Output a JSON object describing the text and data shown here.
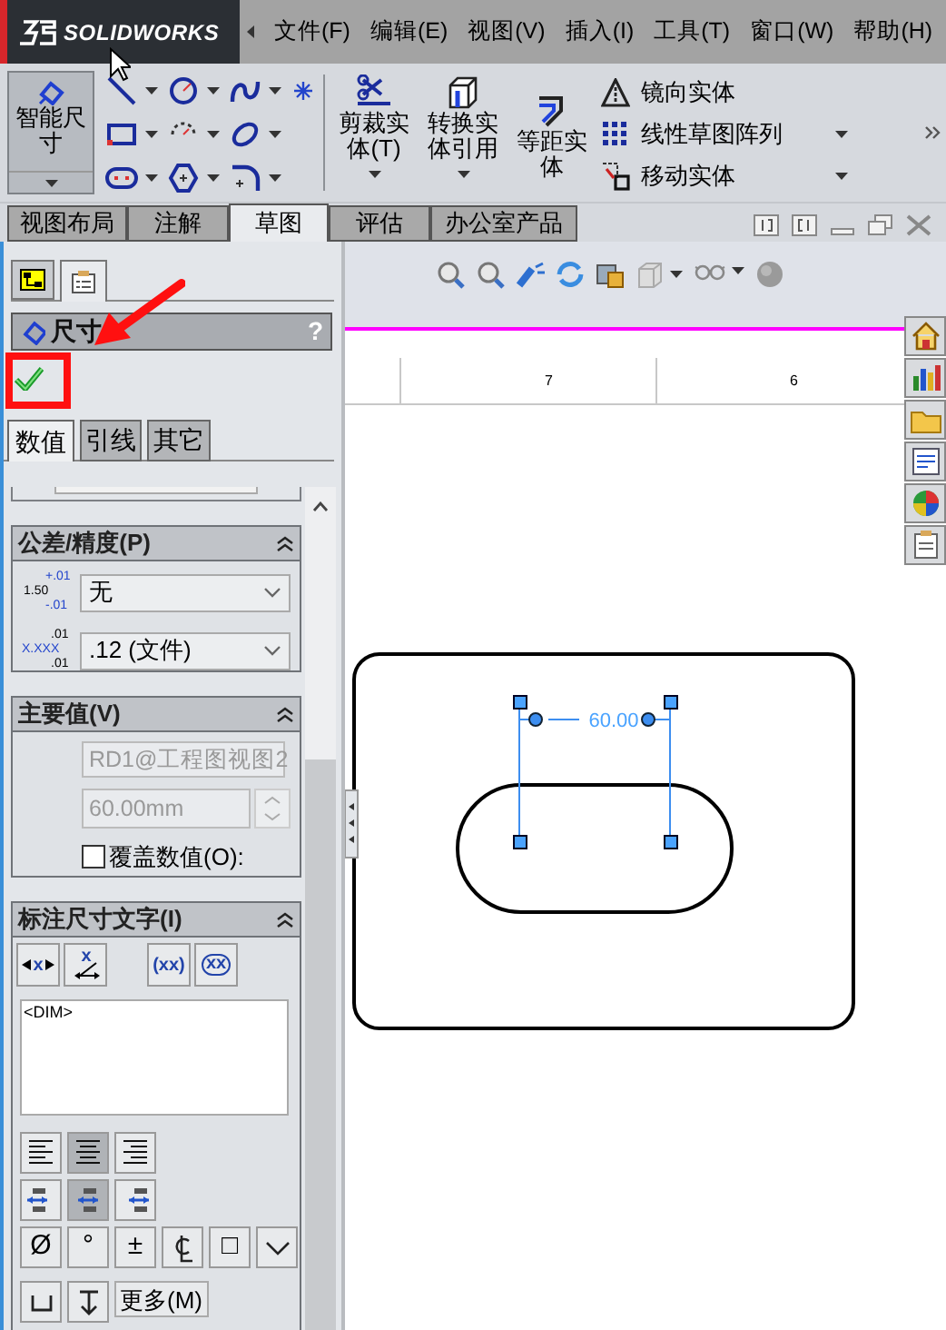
{
  "logo": "SOLIDWORKS",
  "menu": [
    "文件(F)",
    "编辑(E)",
    "视图(V)",
    "插入(I)",
    "工具(T)",
    "窗口(W)",
    "帮助(H)"
  ],
  "ribbon": {
    "smart_dimension": {
      "label": "智能尺寸",
      "selected": true
    },
    "big_tools": [
      {
        "kind": "trim",
        "label": "剪裁实体(T)"
      },
      {
        "kind": "convert",
        "label": "转换实体引用"
      },
      {
        "kind": "offset",
        "label": "等距实体"
      }
    ],
    "list_tools": [
      {
        "kind": "mirror",
        "label": "镜向实体"
      },
      {
        "kind": "pattern",
        "label": "线性草图阵列"
      },
      {
        "kind": "move",
        "label": "移动实体"
      }
    ]
  },
  "tabs": [
    {
      "label": "视图布局",
      "selected": false
    },
    {
      "label": "注解",
      "selected": false
    },
    {
      "label": "草图",
      "selected": true
    },
    {
      "label": "评估",
      "selected": false
    },
    {
      "label": "办公室产品",
      "selected": false
    }
  ],
  "property_manager": {
    "title": "尺寸",
    "help": "?",
    "tabs": [
      {
        "label": "数值",
        "selected": true
      },
      {
        "label": "引线",
        "selected": false
      },
      {
        "label": "其它",
        "selected": false
      }
    ],
    "tolerance": {
      "title": "公差/精度(P)",
      "icon_value": "1.50",
      "icon_upper": "+.01",
      "icon_lower": "-.01",
      "type": "无",
      "precision_top": ".01",
      "precision_middle": "X.XXX",
      "precision_bottom": ".01",
      "precision": ".12 (文件)"
    },
    "primary_value": {
      "title": "主要值(V)",
      "reference": "RD1@工程图视图2",
      "value": "60.00mm",
      "override": {
        "label": "覆盖数值(O):",
        "checked": false
      }
    },
    "dimension_text": {
      "title": "标注尺寸文字(I)",
      "format_buttons": [
        {
          "kind": "arrows",
          "glyph": "x"
        },
        {
          "kind": "angled",
          "glyph": "x"
        },
        {
          "kind": "parens",
          "glyph": "(xx)"
        },
        {
          "kind": "inspection",
          "glyph": "xx"
        }
      ],
      "text": "<DIM>",
      "justify": [
        {
          "kind": "left",
          "selected": false
        },
        {
          "kind": "center",
          "selected": true
        },
        {
          "kind": "right",
          "selected": false
        }
      ],
      "arrow_align": [
        {
          "kind": "left",
          "selected": false
        },
        {
          "kind": "center",
          "selected": true
        },
        {
          "kind": "right",
          "selected": false
        }
      ],
      "symbols": [
        {
          "kind": "text",
          "glyph": "Ø"
        },
        {
          "kind": "text",
          "glyph": "°"
        },
        {
          "kind": "text",
          "glyph": "±"
        },
        {
          "kind": "centerline"
        },
        {
          "kind": "text",
          "glyph": "□"
        },
        {
          "kind": "more"
        }
      ],
      "more": "更多(M)"
    }
  },
  "ruler": [
    "7",
    "6"
  ],
  "sketch": {
    "dimension": "60.00"
  }
}
